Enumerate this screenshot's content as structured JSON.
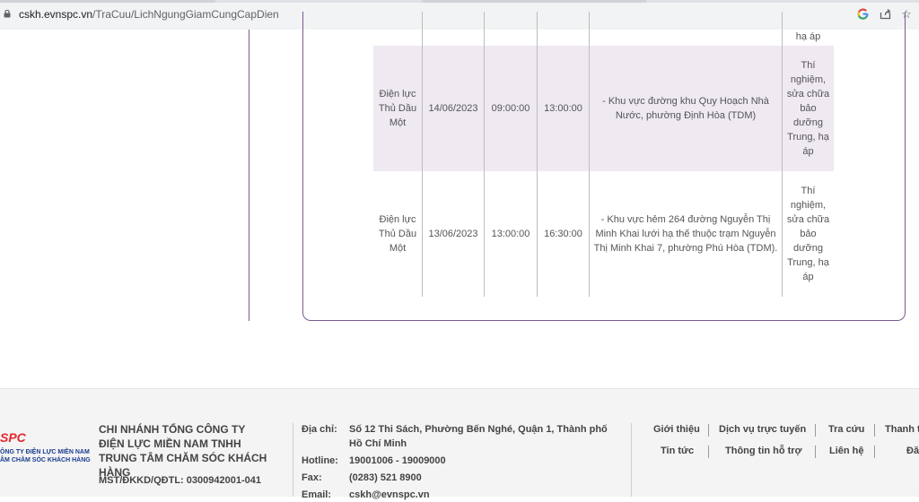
{
  "browser": {
    "url_host": "cskh.evnspc.vn",
    "url_path": "/TraCuu/LichNgungGiamCungCapDien",
    "icons": [
      "lock-icon",
      "google-icon",
      "share-icon",
      "star-icon"
    ]
  },
  "table": {
    "rows": [
      {
        "unit": "",
        "date": "",
        "start": "",
        "end": "",
        "area": "",
        "reason": "hạ áp"
      },
      {
        "unit": "Điện lực Thủ Dầu Một",
        "date": "14/06/2023",
        "start": "09:00:00",
        "end": "13:00:00",
        "area": "- Khu vực đường khu Quy Hoạch Nhà Nước, phường Định Hòa (TDM)",
        "reason": "Thí nghiệm, sửa chữa bảo dưỡng Trung, hạ áp"
      },
      {
        "unit": "Điện lực Thủ Dầu Một",
        "date": "13/06/2023",
        "start": "13:00:00",
        "end": "16:30:00",
        "area": "- Khu vực hẻm 264 đường Nguyễn Thị Minh Khai lưới hạ thế thuộc trạm Nguyễn Thị Minh Khai 7, phường Phú Hòa (TDM).",
        "reason": "Thí nghiệm, sửa chữa bảo dưỡng Trung, hạ áp"
      }
    ]
  },
  "footer": {
    "logo_mark": "SPC",
    "logo_line1": "ÔNG TY ĐIỆN LỰC MIỀN NAM",
    "logo_line2": "ÂM CHĂM SÓC KHÁCH HÀNG",
    "company": "CHI NHÁNH TỔNG CÔNG TY ĐIỆN LỰC MIỀN NAM TNHH TRUNG TÂM CHĂM SÓC KHÁCH HÀNG",
    "mst": "MST/ĐKKD/QĐTL: 0300942001-041",
    "address_label": "Địa chỉ:",
    "address_value": "Số 12 Thi Sách, Phường Bến Nghé, Quận 1, Thành phố Hồ Chí Minh",
    "hotline_label": "Hotline:",
    "hotline_value": "19001006 - 19009000",
    "fax_label": "Fax:",
    "fax_value": "(0283) 521 8900",
    "email_label": "Email:",
    "email_value": "cskh@evnspc.vn",
    "links_row1": [
      "Giới thiệu",
      "Dịch vụ trực tuyến",
      "Tra cứu",
      "Thanh t"
    ],
    "links_row2": [
      "Tin tức",
      "Thông tin hỗ trợ",
      "Liên hệ",
      "Đă"
    ]
  }
}
